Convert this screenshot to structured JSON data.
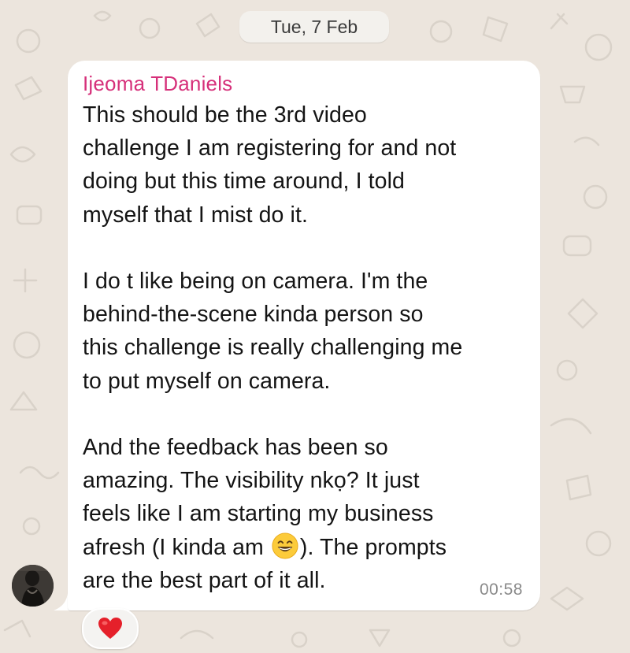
{
  "date_separator": "Tue, 7 Feb",
  "message": {
    "sender_name": "Ijeoma TDaniels",
    "sender_color": "#d6307a",
    "lines": [
      "This should be the 3rd video",
      "challenge I am registering for and not",
      "doing but this time around, I told",
      "myself that I mist do it.",
      "",
      "I do t like being on camera. I'm the",
      "behind-the-scene kinda person so",
      "this challenge is really challenging me",
      "to put myself on camera.",
      "",
      "And the feedback has been so",
      "amazing. The visibility nkọ? It just",
      "feels like I am starting my business"
    ],
    "line_emoji_before": "afresh (I kinda am ",
    "emoji": "grinning-face-with-smiling-eyes",
    "line_emoji_after": "). The prompts",
    "last_line": "are the best part of it all.",
    "time": "00:58"
  },
  "avatar": "sender-avatar-photo",
  "reaction": {
    "icon": "red-heart",
    "color": "#e5202a"
  }
}
